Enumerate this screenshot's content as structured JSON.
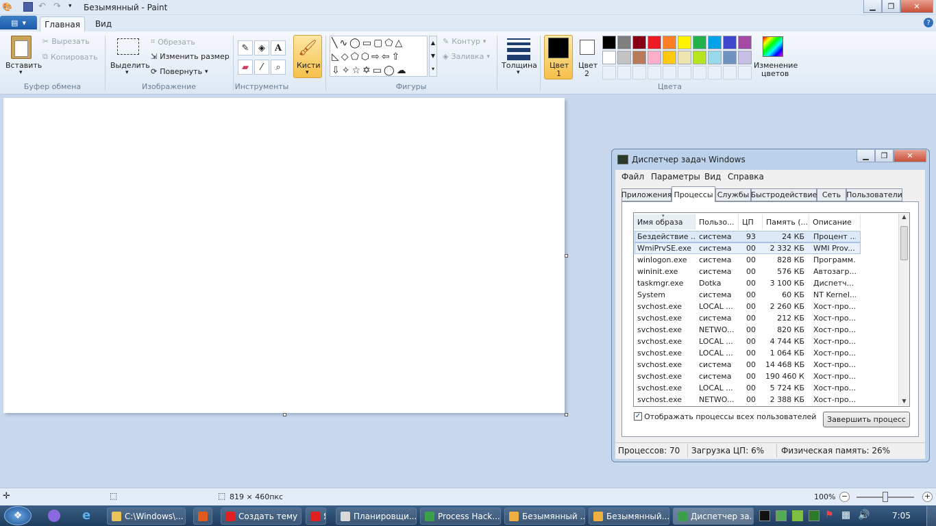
{
  "paint": {
    "title": "Безымянный - Paint",
    "tabs": {
      "home": "Главная",
      "view": "Вид"
    },
    "clipboard": {
      "paste": "Вставить",
      "cut": "Вырезать",
      "copy": "Копировать",
      "label": "Буфер обмена"
    },
    "image": {
      "select": "Выделить",
      "crop": "Обрезать",
      "resize": "Изменить размер",
      "rotate": "Повернуть",
      "label": "Изображение"
    },
    "tools": {
      "label": "Инструменты",
      "text_tool": "A"
    },
    "brushes": {
      "label": "Кисти"
    },
    "shapes": {
      "outline": "Контур",
      "fill": "Заливка",
      "label": "Фигуры"
    },
    "size": {
      "label": "Толщина"
    },
    "color1": {
      "label": "Цвет",
      "num": "1",
      "value": "#000000"
    },
    "color2": {
      "label": "Цвет",
      "num": "2",
      "value": "#ffffff"
    },
    "colors": {
      "label": "Цвета",
      "edit_line1": "Изменение",
      "edit_line2": "цветов",
      "row1": [
        "#000000",
        "#7f7f7f",
        "#880015",
        "#ed1c24",
        "#ff7f27",
        "#fff200",
        "#22b14c",
        "#00a2e8",
        "#3f48cc",
        "#a349a4"
      ],
      "row2": [
        "#ffffff",
        "#c3c3c3",
        "#b97a57",
        "#ffaec9",
        "#ffc90e",
        "#efe4b0",
        "#b5e61d",
        "#99d9ea",
        "#7092be",
        "#c8bfe7"
      ]
    },
    "status": {
      "size": "819 × 460пкс",
      "zoom": "100%"
    }
  },
  "taskmgr": {
    "title": "Диспетчер задач Windows",
    "menu": [
      "Файл",
      "Параметры",
      "Вид",
      "Справка"
    ],
    "tabs": [
      "Приложения",
      "Процессы",
      "Службы",
      "Быстродействие",
      "Сеть",
      "Пользователи"
    ],
    "columns": [
      "Имя образа",
      "Пользо...",
      "ЦП",
      "Память (...",
      "Описание"
    ],
    "rows": [
      [
        "Бездействие ...",
        "система",
        "93",
        "24 КБ",
        "Процент ..."
      ],
      [
        "WmiPrvSE.exe",
        "система",
        "00",
        "2 332 КБ",
        "WMI Prov..."
      ],
      [
        "winlogon.exe",
        "система",
        "00",
        "828 КБ",
        "Программ..."
      ],
      [
        "wininit.exe",
        "система",
        "00",
        "576 КБ",
        "Автозагр..."
      ],
      [
        "taskmgr.exe",
        "Dotka",
        "00",
        "3 100 КБ",
        "Диспетч..."
      ],
      [
        "System",
        "система",
        "00",
        "60 КБ",
        "NT Kernel..."
      ],
      [
        "svchost.exe",
        "LOCAL ...",
        "00",
        "2 260 КБ",
        "Хост-про..."
      ],
      [
        "svchost.exe",
        "система",
        "00",
        "212 КБ",
        "Хост-про..."
      ],
      [
        "svchost.exe",
        "NETWO...",
        "00",
        "820 КБ",
        "Хост-про..."
      ],
      [
        "svchost.exe",
        "LOCAL ...",
        "00",
        "4 744 КБ",
        "Хост-про..."
      ],
      [
        "svchost.exe",
        "LOCAL ...",
        "00",
        "1 064 КБ",
        "Хост-про..."
      ],
      [
        "svchost.exe",
        "система",
        "00",
        "14 468 КБ",
        "Хост-про..."
      ],
      [
        "svchost.exe",
        "система",
        "00",
        "190 460 КБ",
        "Хост-про..."
      ],
      [
        "svchost.exe",
        "LOCAL ...",
        "00",
        "5 724 КБ",
        "Хост-про..."
      ],
      [
        "svchost.exe",
        "NETWO...",
        "00",
        "2 388 КБ",
        "Хост-про..."
      ]
    ],
    "show_all": "Отображать процессы всех пользователей",
    "end_process": "Завершить процесс",
    "status": {
      "processes": "Процессов: 70",
      "cpu": "Загрузка ЦП: 6%",
      "memory": "Физическая память: 26%"
    }
  },
  "taskbar": {
    "items": [
      {
        "label": "C:\\Windows\\...",
        "color": "#e8c35a"
      },
      {
        "label": "",
        "color": "#e05a1e"
      },
      {
        "label": "Создать тему ...",
        "color": "#e02020"
      },
      {
        "label": "Я",
        "color": "#e02020"
      },
      {
        "label": "Планировщи...",
        "color": "#d9d9d9"
      },
      {
        "label": "Process Hack...",
        "color": "#3aa04a"
      },
      {
        "label": "Безымянный ...",
        "color": "#f0b040"
      },
      {
        "label": "Безымянный...",
        "color": "#f0b040"
      },
      {
        "label": "Диспетчер за...",
        "color": "#3aa04a"
      }
    ],
    "clock": "7:05"
  }
}
